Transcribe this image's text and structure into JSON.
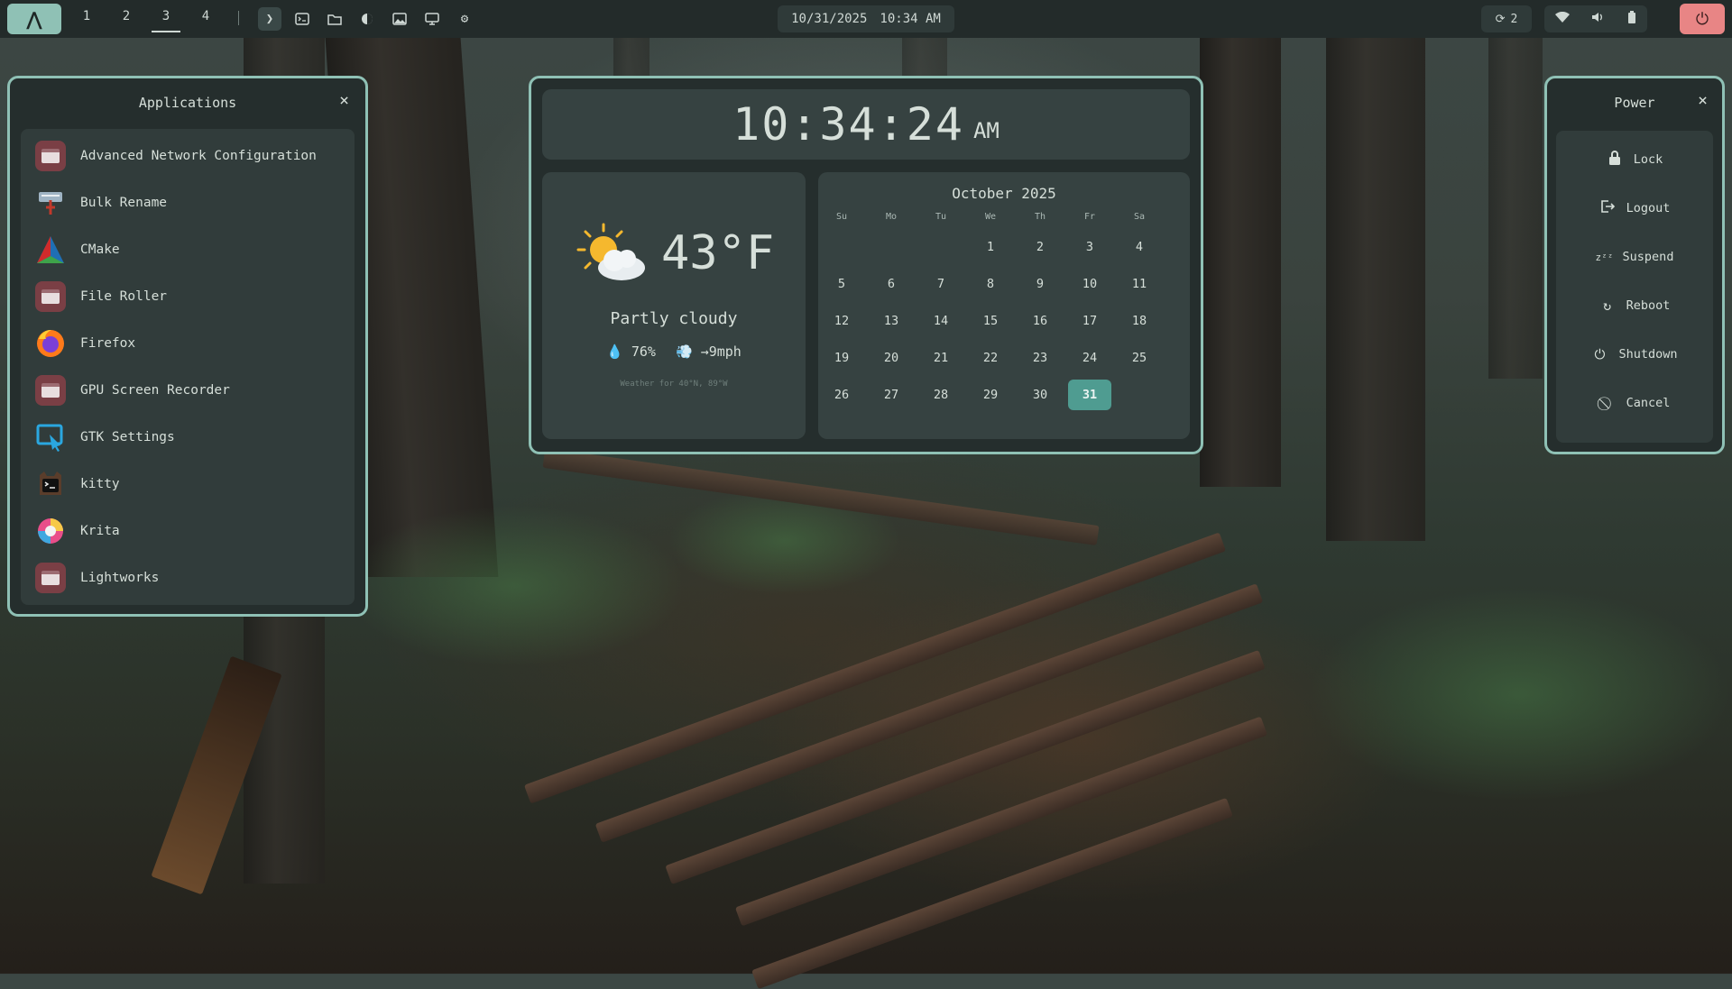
{
  "topbar": {
    "workspaces": [
      "1",
      "2",
      "3",
      "4"
    ],
    "active_workspace": "3",
    "date": "10/31/2025",
    "time": "10:34 AM",
    "notification_count": "2"
  },
  "apps_panel": {
    "title": "Applications",
    "close": "×",
    "items": [
      {
        "label": "Advanced Network Configuration",
        "icon": "window-icon"
      },
      {
        "label": "Bulk Rename",
        "icon": "bulk-rename-icon"
      },
      {
        "label": "CMake",
        "icon": "cmake-icon"
      },
      {
        "label": "File Roller",
        "icon": "window-icon"
      },
      {
        "label": "Firefox",
        "icon": "firefox-icon"
      },
      {
        "label": "GPU Screen Recorder",
        "icon": "window-icon"
      },
      {
        "label": "GTK Settings",
        "icon": "gtk-settings-icon"
      },
      {
        "label": "kitty",
        "icon": "kitty-icon"
      },
      {
        "label": "Krita",
        "icon": "krita-icon"
      },
      {
        "label": "Lightworks",
        "icon": "window-icon"
      }
    ]
  },
  "clock": {
    "time": "10:34:24",
    "ampm": "AM"
  },
  "weather": {
    "icon": "partly-cloudy-icon",
    "temp": "43°F",
    "desc": "Partly cloudy",
    "humidity": "76%",
    "wind": "→9mph",
    "footnote": "Weather for 40°N, 89°W"
  },
  "calendar": {
    "title": "October 2025",
    "dow": [
      "Su",
      "Mo",
      "Tu",
      "We",
      "Th",
      "Fr",
      "Sa"
    ],
    "first_weekday": 3,
    "days_in_month": 31,
    "today": 31
  },
  "power_panel": {
    "title": "Power",
    "close": "×",
    "items": [
      {
        "label": "Lock",
        "icon": "lock-icon"
      },
      {
        "label": "Logout",
        "icon": "logout-icon"
      },
      {
        "label": "Suspend",
        "icon": "suspend-icon"
      },
      {
        "label": "Reboot",
        "icon": "reboot-icon"
      },
      {
        "label": "Shutdown",
        "icon": "shutdown-icon"
      },
      {
        "label": "Cancel",
        "icon": "cancel-icon"
      }
    ]
  },
  "colors": {
    "accent": "#8fc1b5",
    "panel_bg": "#252e2d",
    "today": "#4f9c91",
    "power_button": "#e88585"
  }
}
